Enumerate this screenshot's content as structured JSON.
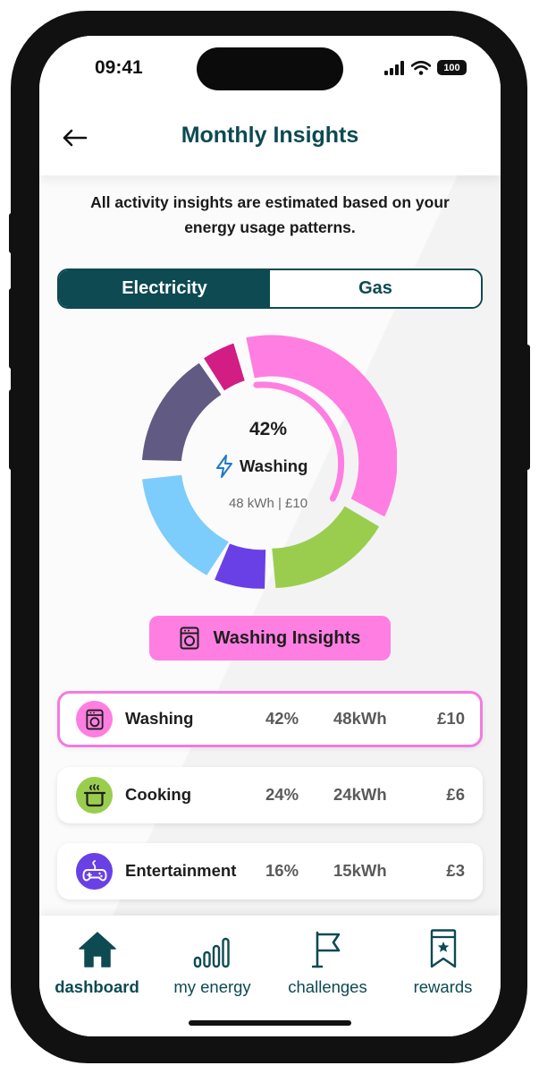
{
  "status_bar": {
    "time": "09:41",
    "battery": "100"
  },
  "header": {
    "title": "Monthly Insights",
    "back_icon": "arrow-left-icon"
  },
  "disclaimer": "All activity insights are estimated based on your energy usage patterns.",
  "energy_toggle": {
    "options": [
      "Electricity",
      "Gas"
    ],
    "selected": "Electricity"
  },
  "donut": {
    "selected": {
      "percent": "42%",
      "label": "Washing",
      "detail": "48 kWh | £10",
      "icon": "lightning-icon"
    },
    "segments": [
      {
        "name": "Washing",
        "percent": 42,
        "color": "#ff7ee2"
      },
      {
        "name": "Cooking",
        "percent": 24,
        "color": "#9acd4e"
      },
      {
        "name": "Entertainment",
        "percent": 16,
        "color": "#7dcdfc"
      }
    ],
    "other_segment_colors": [
      "#6940e6",
      "#615b83",
      "#d11d84"
    ]
  },
  "insights_button": {
    "label": "Washing Insights",
    "icon": "washing-machine-icon",
    "color": "#ff7ee2"
  },
  "activities": [
    {
      "name": "Washing",
      "percent": "42%",
      "kwh": "48kWh",
      "cost": "£10",
      "icon": "washing-machine-icon",
      "icon_bg": "#ff7ee2",
      "selected": true
    },
    {
      "name": "Cooking",
      "percent": "24%",
      "kwh": "24kWh",
      "cost": "£6",
      "icon": "cooking-pot-icon",
      "icon_bg": "#9acd4e",
      "selected": false
    },
    {
      "name": "Entertainment",
      "percent": "16%",
      "kwh": "15kWh",
      "cost": "£3",
      "icon": "game-controller-icon",
      "icon_bg": "#6940e6",
      "selected": false
    }
  ],
  "bottom_nav": [
    {
      "label": "dashboard",
      "icon": "home-icon",
      "active": true
    },
    {
      "label": "my energy",
      "icon": "bar-chart-icon",
      "active": false
    },
    {
      "label": "challenges",
      "icon": "flag-icon",
      "active": false
    },
    {
      "label": "rewards",
      "icon": "reward-ticket-icon",
      "active": false
    }
  ],
  "colors": {
    "primary": "#0d4a52",
    "accent_pink": "#ff7ee2"
  }
}
